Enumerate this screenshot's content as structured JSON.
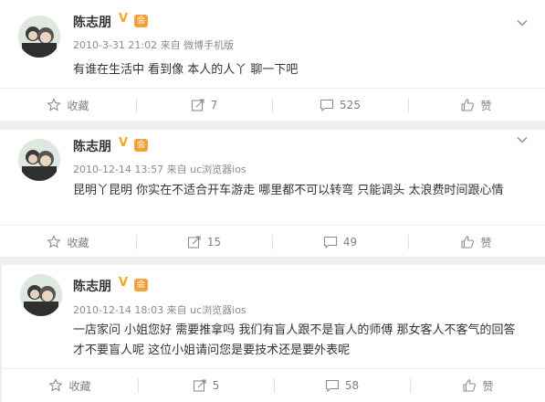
{
  "posts": [
    {
      "author": "陈志朋",
      "verified_mark": "V",
      "level_badge": "会",
      "meta": "2010-3-31 21:02 来自 微博手机版",
      "content": "有谁在生活中 看到像 本人的人丫 聊一下吧",
      "actions": {
        "favorite": "收藏",
        "repost": "7",
        "comment": "525",
        "like": "赞"
      }
    },
    {
      "author": "陈志朋",
      "verified_mark": "V",
      "level_badge": "会",
      "meta": "2010-12-14 13:57 来自 uc浏览器ios",
      "content": "昆明丫昆明 你实在不适合开车游走 哪里都不可以转弯 只能调头 太浪费时间跟心情",
      "actions": {
        "favorite": "收藏",
        "repost": "15",
        "comment": "49",
        "like": "赞"
      }
    },
    {
      "author": "陈志朋",
      "verified_mark": "V",
      "level_badge": "会",
      "meta": "2010-12-14 18:03 来自 uc浏览器ios",
      "content": "一店家问 小姐您好 需要推拿吗 我们有盲人跟不是盲人的师傅 那女客人不客气的回答 才不要盲人呢 这位小姐请问您是要技术还是要外表呢",
      "actions": {
        "favorite": "收藏",
        "repost": "5",
        "comment": "58",
        "like": "赞"
      }
    }
  ],
  "colors": {
    "verified": "#f5a623",
    "level_badge": "#f1a33a",
    "meta": "#8a8a8a",
    "action": "#808080"
  }
}
